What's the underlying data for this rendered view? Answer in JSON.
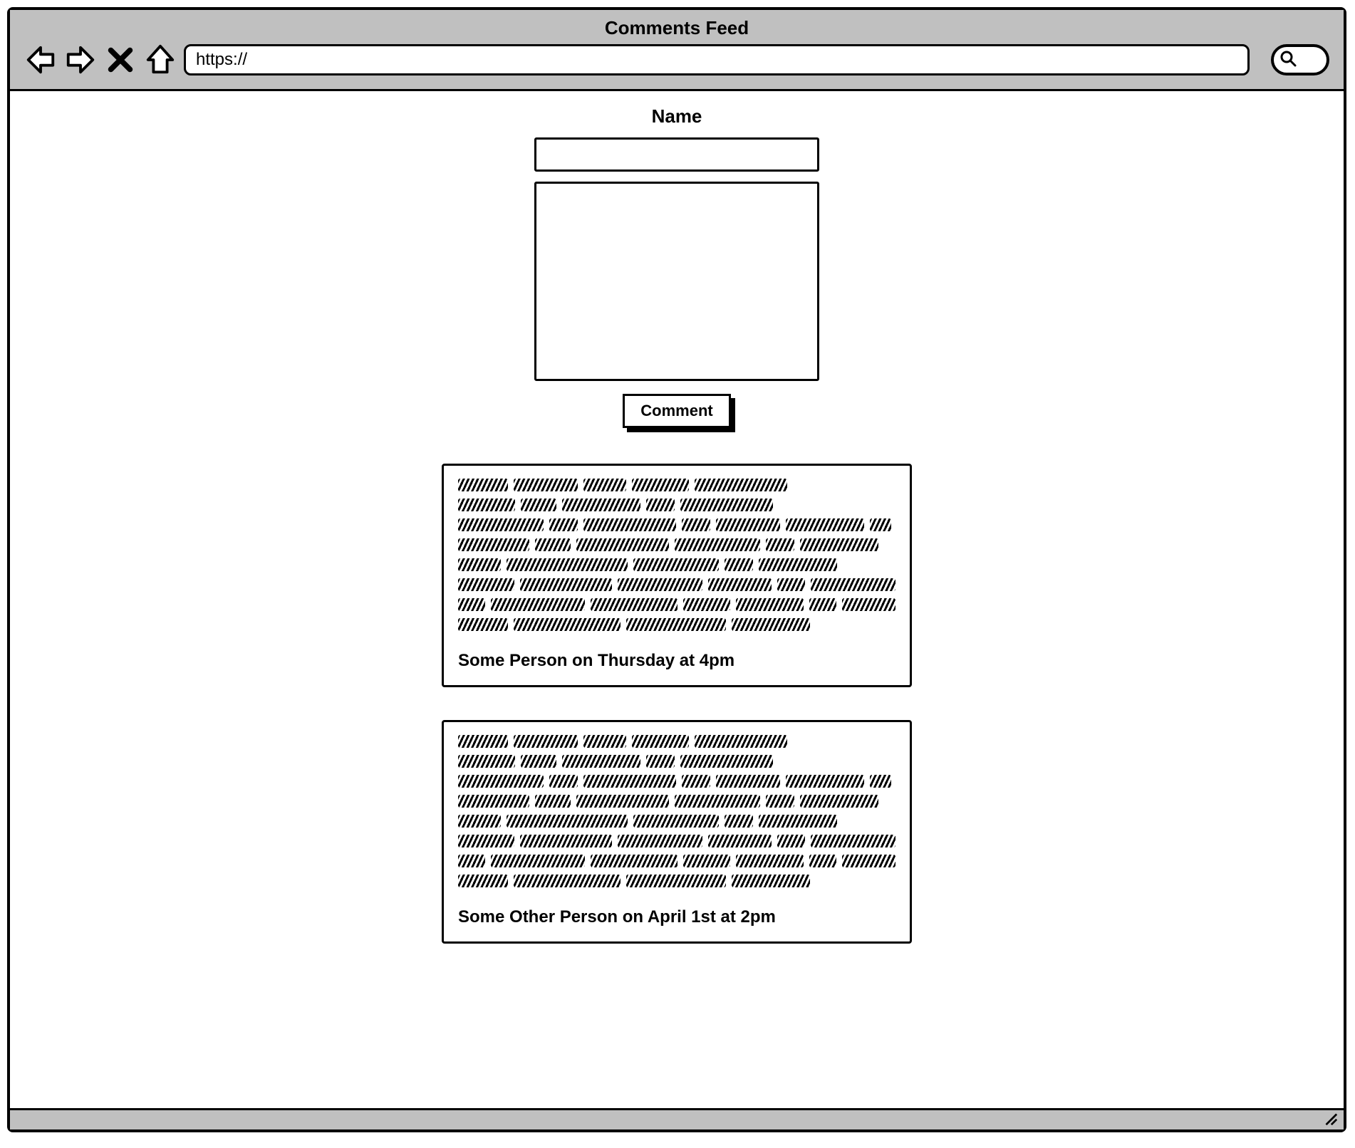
{
  "browser": {
    "title": "Comments Feed",
    "url": "https://"
  },
  "form": {
    "name_label": "Name",
    "name_value": "",
    "comment_value": "",
    "submit_label": "Comment"
  },
  "comments": [
    {
      "meta": "Some Person on Thursday at 4pm"
    },
    {
      "meta": "Some Other Person on April 1st at 2pm"
    }
  ]
}
